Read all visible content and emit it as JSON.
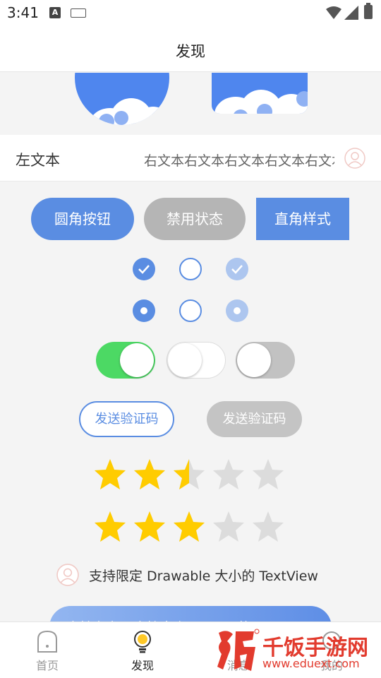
{
  "status_bar": {
    "time": "3:41",
    "notification_icon_letter": "A"
  },
  "header": {
    "title": "发现"
  },
  "text_row": {
    "left_text": "左文本",
    "right_text": "右文本右文本右文本右文本右文本"
  },
  "buttons": {
    "round_label": "圆角按钮",
    "disabled_label": "禁用状态",
    "square_label": "直角样式"
  },
  "checkboxes": [
    {
      "state": "checked",
      "enabled": true
    },
    {
      "state": "unchecked",
      "enabled": true
    },
    {
      "state": "checked",
      "enabled": false
    }
  ],
  "radios": [
    {
      "state": "checked",
      "enabled": true
    },
    {
      "state": "unchecked",
      "enabled": true
    },
    {
      "state": "checked",
      "enabled": false
    }
  ],
  "switches": [
    {
      "state": "on",
      "enabled": true
    },
    {
      "state": "off",
      "enabled": true
    },
    {
      "state": "off",
      "enabled": false
    }
  ],
  "send_code": {
    "active_label": "发送验证码",
    "disabled_label": "发送验证码"
  },
  "ratings": [
    {
      "value": 2.5,
      "max": 5
    },
    {
      "value": 3,
      "max": 5
    }
  ],
  "drawable_text": {
    "label": "支持限定 Drawable 大小的 TextView"
  },
  "shape_pill": {
    "label": "支持在布局直接定义 Shape 的 TextView"
  },
  "tabbar": {
    "items": [
      {
        "label": "首页",
        "icon": "home-icon",
        "active": false
      },
      {
        "label": "发现",
        "icon": "lightbulb-icon",
        "active": true
      },
      {
        "label": "消息",
        "icon": "message-icon",
        "active": false
      },
      {
        "label": "我的",
        "icon": "profile-icon",
        "active": false
      }
    ]
  },
  "watermark": {
    "text": "千饭手游网",
    "url": "www.eduext.com"
  },
  "colors": {
    "accent": "#5a8de2",
    "disabled": "#b5b5b5",
    "switch_on": "#4cd964",
    "star_active": "#ffcc00",
    "star_inactive": "#dcdcdc",
    "watermark": "#e23b2e"
  }
}
